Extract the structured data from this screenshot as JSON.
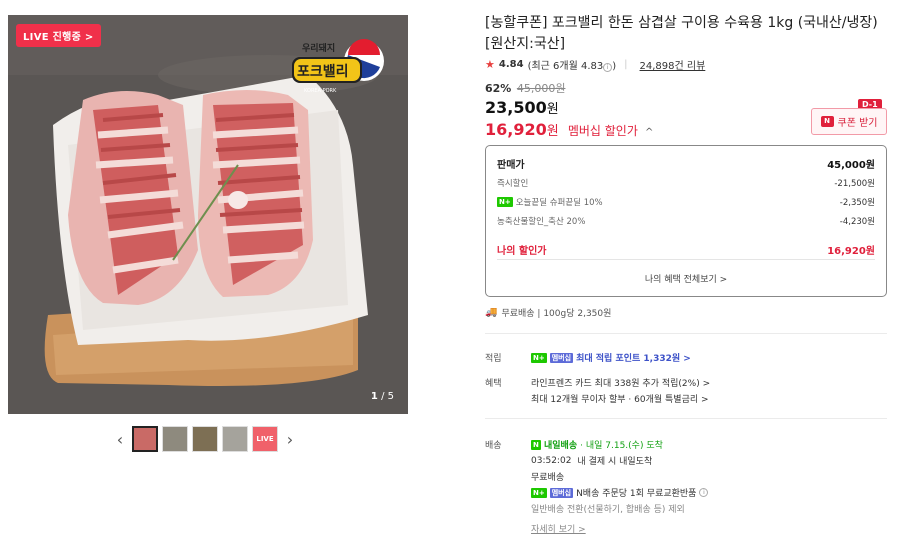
{
  "image": {
    "live_badge": "LIVE 진행중 >",
    "logo_small": "우리돼지",
    "logo_big": "포크밸리",
    "logo_sub": "KOREA PORK",
    "counter_current": "1",
    "counter_total": "/ 5",
    "thumb_live": "LIVE"
  },
  "product": {
    "title": "[농할쿠폰] 포크밸리 한돈 삼겹살 구이용 수육용 1kg (국내산/냉장) [원산지:국산]",
    "rating_value": "4.84",
    "rating_recent": "(최근 6개월 4.83",
    "rating_recent_end": ")",
    "reviews": "24,898건 리뷰",
    "discount_pct": "62%",
    "original_price": "45,000원",
    "price": "23,500",
    "price_unit": "원",
    "member_price": "16,920",
    "member_unit": "원",
    "member_label": "멤버십 할인가",
    "coupon_label": "쿠폰 받기",
    "dday": "D-1"
  },
  "breakdown": {
    "head_label": "판매가",
    "head_amount": "45,000원",
    "rows": [
      {
        "label": "즉시할인",
        "amount": "-21,500원"
      },
      {
        "label": "오늘끝딜 슈퍼끝딜 10%",
        "amount": "-2,350원"
      },
      {
        "label": "농축산물할인_축산 20%",
        "amount": "-4,230원"
      }
    ],
    "mine_label": "나의 할인가",
    "mine_amount": "16,920원",
    "more": "나의 혜택 전체보기 >"
  },
  "shipping_line": "무료배송 | 100g당 2,350원",
  "points": {
    "label": "적립",
    "text": "최대 적립 포인트 1,332원 >"
  },
  "benefits": {
    "label": "혜택",
    "line1": "라인프렌즈 카드 최대 338원 추가 적립(2%) >",
    "line2": "최대 12개월 무이자 할부 · 60개월 특별금리 >"
  },
  "delivery": {
    "label": "배송",
    "brand": "내일배송",
    "arrive": "· 내일 7.15.(수) 도착",
    "time": "03:52:02",
    "time_text": "내 결제 시 내일도착",
    "free": "무료배송",
    "nship": "N배송 주문당 1회 무료교환반품",
    "exclude": "일반배송 전환(선물하기, 합배송 등) 제외",
    "more": "자세히 보기 >"
  },
  "badges": {
    "nplus": "N+",
    "membership": "멤버십"
  }
}
